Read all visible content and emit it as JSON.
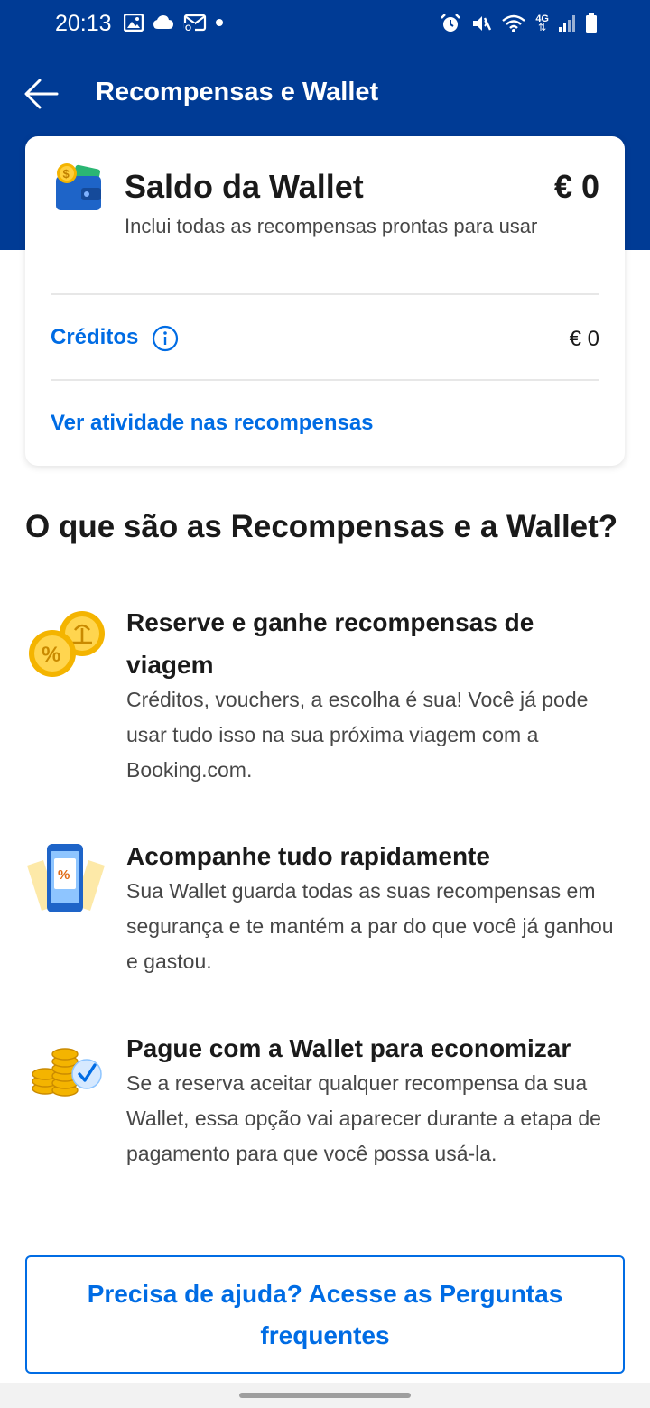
{
  "status_bar": {
    "time": "20:13",
    "left_icons": [
      "image-icon",
      "cloud-icon",
      "mail-icon"
    ],
    "right_icons": [
      "alarm-icon",
      "mute-icon",
      "wifi-icon",
      "network-4g-icon",
      "signal-icon",
      "battery-icon"
    ],
    "network_label": "4G"
  },
  "app_bar": {
    "title": "Recompensas e Wallet",
    "back_icon": "arrow-left-icon"
  },
  "wallet": {
    "title": "Saldo da Wallet",
    "amount": "€ 0",
    "subtitle": "Inclui todas as recompensas prontas para usar",
    "credits_label": "Créditos",
    "credits_amount": "€ 0",
    "activity_link": "Ver atividade nas recompensas"
  },
  "section_title": "O que são as Recompensas e a Wallet?",
  "features": [
    {
      "icon": "coins-icon",
      "title": "Reserve e ganhe recompensas de viagem",
      "description": "Créditos, vouchers, a escolha é sua! Você já pode usar tudo isso na sua próxima viagem com a Booking.com."
    },
    {
      "icon": "phone-voucher-icon",
      "title": "Acompanhe tudo rapidamente",
      "description": "Sua Wallet guarda todas as suas recompensas em segurança e te mantém a par do que você já ganhou e gastou."
    },
    {
      "icon": "coin-stack-check-icon",
      "title": "Pague com a Wallet para economizar",
      "description": "Se a reserva aceitar qualquer recompensa da sua Wallet, essa opção vai aparecer durante a etapa de pagamento para que você possa usá-la."
    }
  ],
  "help_button": "Precisa de ajuda? Acesse as Perguntas frequentes",
  "colors": {
    "brand_blue": "#003b95",
    "link_blue": "#006ce4"
  }
}
